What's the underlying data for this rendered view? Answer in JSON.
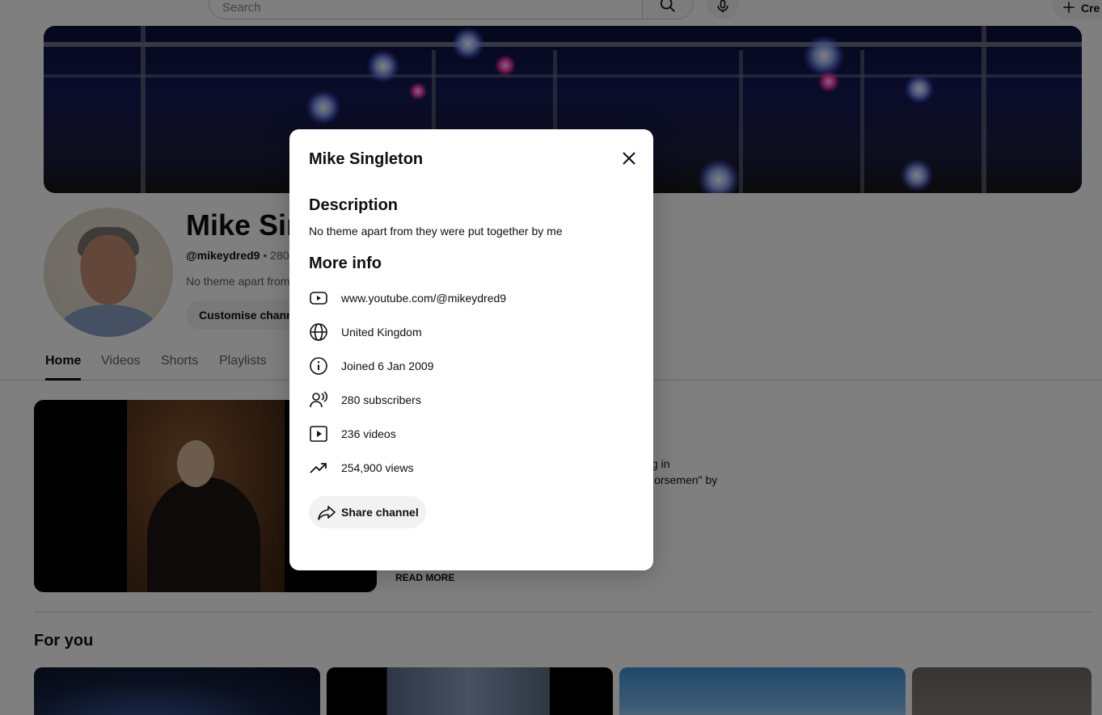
{
  "masthead": {
    "search_placeholder": "Search",
    "create_label": "Cre"
  },
  "channel": {
    "name": "Mike Singleton",
    "name_truncated": "Mike Sir",
    "handle": "@mikeydred9",
    "meta_suffix": " • 280 s",
    "description_truncated": "No theme apart from",
    "customise_label": "Customise channel"
  },
  "tabs": [
    {
      "label": "Home",
      "active": true
    },
    {
      "label": "Videos",
      "active": false
    },
    {
      "label": "Shorts",
      "active": false
    },
    {
      "label": "Playlists",
      "active": false
    }
  ],
  "featured": {
    "text_line1": "g in",
    "text_line2": "lorsemen\" by",
    "read_more": "READ MORE"
  },
  "for_you": {
    "heading": "For you"
  },
  "dialog": {
    "title": "Mike Singleton",
    "description_heading": "Description",
    "description": "No theme apart from they were put together by me",
    "more_info_heading": "More info",
    "info_rows": [
      {
        "icon": "youtube-link-icon",
        "text": "www.youtube.com/@mikeydred9"
      },
      {
        "icon": "globe-icon",
        "text": "United Kingdom"
      },
      {
        "icon": "info-icon",
        "text": "Joined 6 Jan 2009"
      },
      {
        "icon": "subscribers-icon",
        "text": "280 subscribers"
      },
      {
        "icon": "video-play-icon",
        "text": "236 videos"
      },
      {
        "icon": "trending-up-icon",
        "text": "254,900 views"
      }
    ],
    "share_label": "Share channel"
  },
  "colors": {
    "text_primary": "#0f0f0f",
    "text_secondary": "#606060",
    "chip_background": "#f2f2f2",
    "scrim": "rgba(0,0,0,0.5)"
  }
}
